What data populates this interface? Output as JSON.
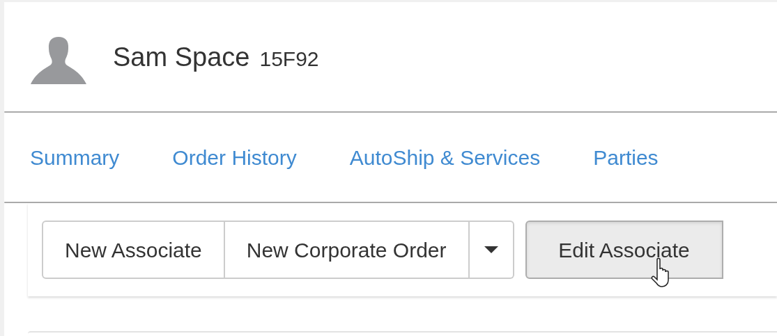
{
  "profile": {
    "name": "Sam Space",
    "id": "15F92"
  },
  "tabs": [
    {
      "label": "Summary"
    },
    {
      "label": "Order History"
    },
    {
      "label": "AutoShip & Services"
    },
    {
      "label": "Parties"
    }
  ],
  "toolbar": {
    "group": [
      {
        "kind": "button",
        "label": "New Associate"
      },
      {
        "kind": "button",
        "label": "New Corporate Order"
      },
      {
        "kind": "caret"
      }
    ],
    "edit_button": {
      "label": "Edit Associate",
      "pressed": true
    }
  }
}
